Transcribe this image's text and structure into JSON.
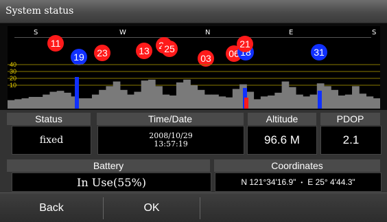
{
  "window": {
    "title": "System status"
  },
  "compass": [
    {
      "label": "S",
      "heading": "south-start"
    },
    {
      "label": "W",
      "heading": "west"
    },
    {
      "label": "N",
      "heading": "north"
    },
    {
      "label": "E",
      "heading": "east"
    },
    {
      "label": "S",
      "heading": "south-end"
    }
  ],
  "satellites": [
    {
      "id": "11",
      "color": "#ff1a1a",
      "state": "red"
    },
    {
      "id": "19",
      "color": "#1030ff",
      "state": "blue"
    },
    {
      "id": "23",
      "color": "#ff1a1a",
      "state": "red"
    },
    {
      "id": "13",
      "color": "#ff1a1a",
      "state": "red"
    },
    {
      "id": "27",
      "color": "#ff1a1a",
      "state": "red"
    },
    {
      "id": "25",
      "color": "#ff1a1a",
      "state": "red"
    },
    {
      "id": "03",
      "color": "#ff1a1a",
      "state": "red"
    },
    {
      "id": "06",
      "color": "#ff1a1a",
      "state": "red"
    },
    {
      "id": "18",
      "color": "#1030ff",
      "state": "blue"
    },
    {
      "id": "21",
      "color": "#ff1a1a",
      "state": "red"
    },
    {
      "id": "31",
      "color": "#1030ff",
      "state": "blue"
    }
  ],
  "signal_chart": {
    "y_ticks": [
      "40",
      "30",
      "20",
      "10"
    ]
  },
  "info": {
    "status_label": "Status",
    "status_value": "fixed",
    "datetime_label": "Time/Date",
    "date_value": "2008/10/29",
    "time_value": "13:57:19",
    "altitude_label": "Altitude",
    "altitude_value": "96.6 M",
    "pdop_label": "PDOP",
    "pdop_value": "2.1",
    "battery_label": "Battery",
    "battery_value": "In Use(55%)",
    "coordinates_label": "Coordinates",
    "latitude": "N 121°34'16.9\"",
    "coord_separator": "•",
    "longitude": "E  25° 4'44.3\""
  },
  "buttons": {
    "back": "Back",
    "ok": "OK"
  },
  "colors": {
    "used_satellite": "#1030ff",
    "unused_satellite": "#ff1a1a",
    "axis": "#e8d000"
  }
}
